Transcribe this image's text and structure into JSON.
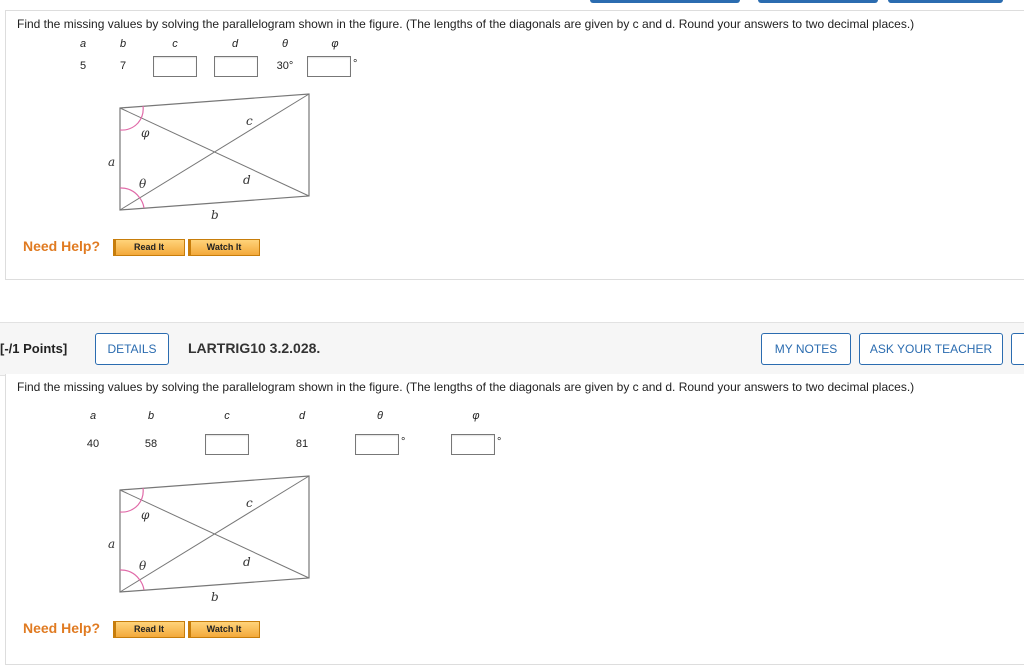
{
  "q1": {
    "prompt": "Find the missing values by solving the parallelogram shown in the figure. (The lengths of the diagonals are given by c and d. Round your answers to two decimal places.)",
    "headers": [
      "a",
      "b",
      "c",
      "d",
      "θ",
      "φ"
    ],
    "a": "5",
    "b": "7",
    "c": "",
    "d": "",
    "theta": "30°",
    "phi": "",
    "deg": "°",
    "figure": {
      "phi": "φ",
      "theta": "θ",
      "a": "a",
      "b": "b",
      "c": "c",
      "d": "d"
    },
    "help_label": "Need Help?",
    "read_it": "Read It",
    "watch_it": "Watch It"
  },
  "q2": {
    "points": "[-/1 Points]",
    "details": "DETAILS",
    "code": "LARTRIG10 3.2.028.",
    "my_notes": "MY NOTES",
    "ask_teacher": "ASK YOUR TEACHER",
    "prompt": "Find the missing values by solving the parallelogram shown in the figure. (The lengths of the diagonals are given by c and d. Round your answers to two decimal places.)",
    "headers": [
      "a",
      "b",
      "c",
      "d",
      "θ",
      "φ"
    ],
    "a": "40",
    "b": "58",
    "c": "",
    "d": "81",
    "theta": "",
    "phi": "",
    "deg": "°",
    "figure": {
      "phi": "φ",
      "theta": "θ",
      "a": "a",
      "b": "b",
      "c": "c",
      "d": "d"
    },
    "help_label": "Need Help?",
    "read_it": "Read It",
    "watch_it": "Watch It"
  },
  "colors": {
    "accent": "#2b6cb0",
    "help": "#e07b22",
    "button_fill": "#f3a93b",
    "angle_arc": "#e06aa8"
  }
}
